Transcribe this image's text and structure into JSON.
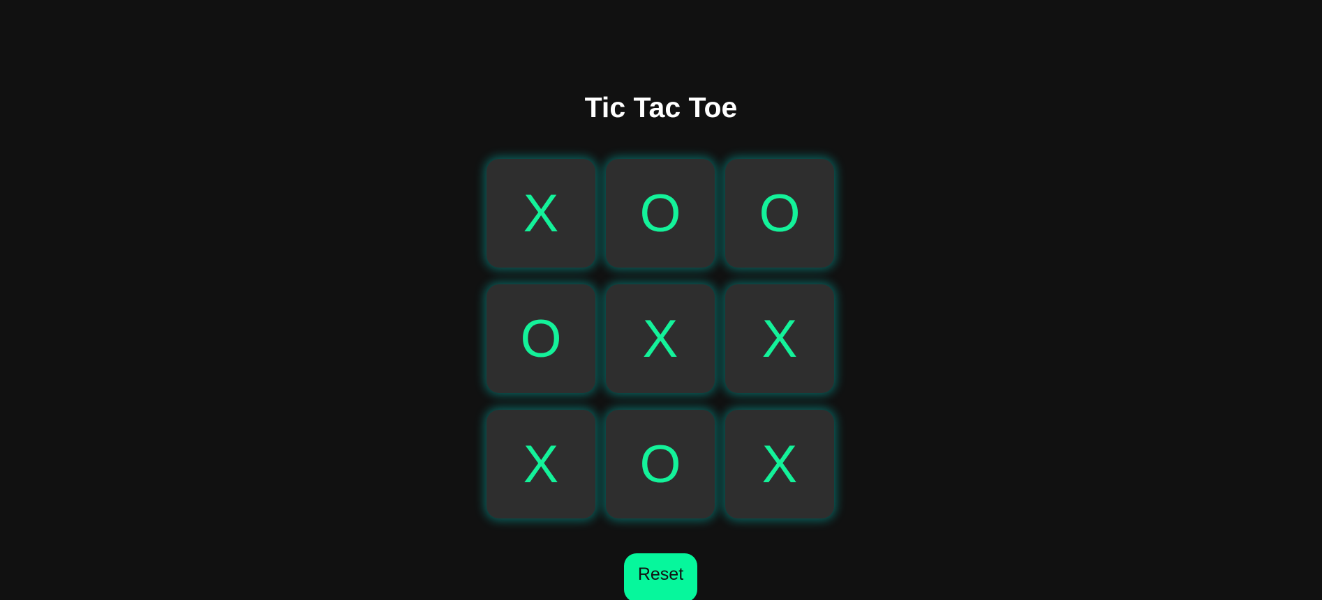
{
  "title": "Tic Tac Toe",
  "board": {
    "cells": [
      "X",
      "O",
      "O",
      "O",
      "X",
      "X",
      "X",
      "O",
      "X"
    ]
  },
  "reset_label": "Reset",
  "colors": {
    "background": "#111111",
    "cell": "#2e2e2e",
    "mark": "#14f29a",
    "glow": "#00c8be",
    "button": "#06f79c"
  }
}
